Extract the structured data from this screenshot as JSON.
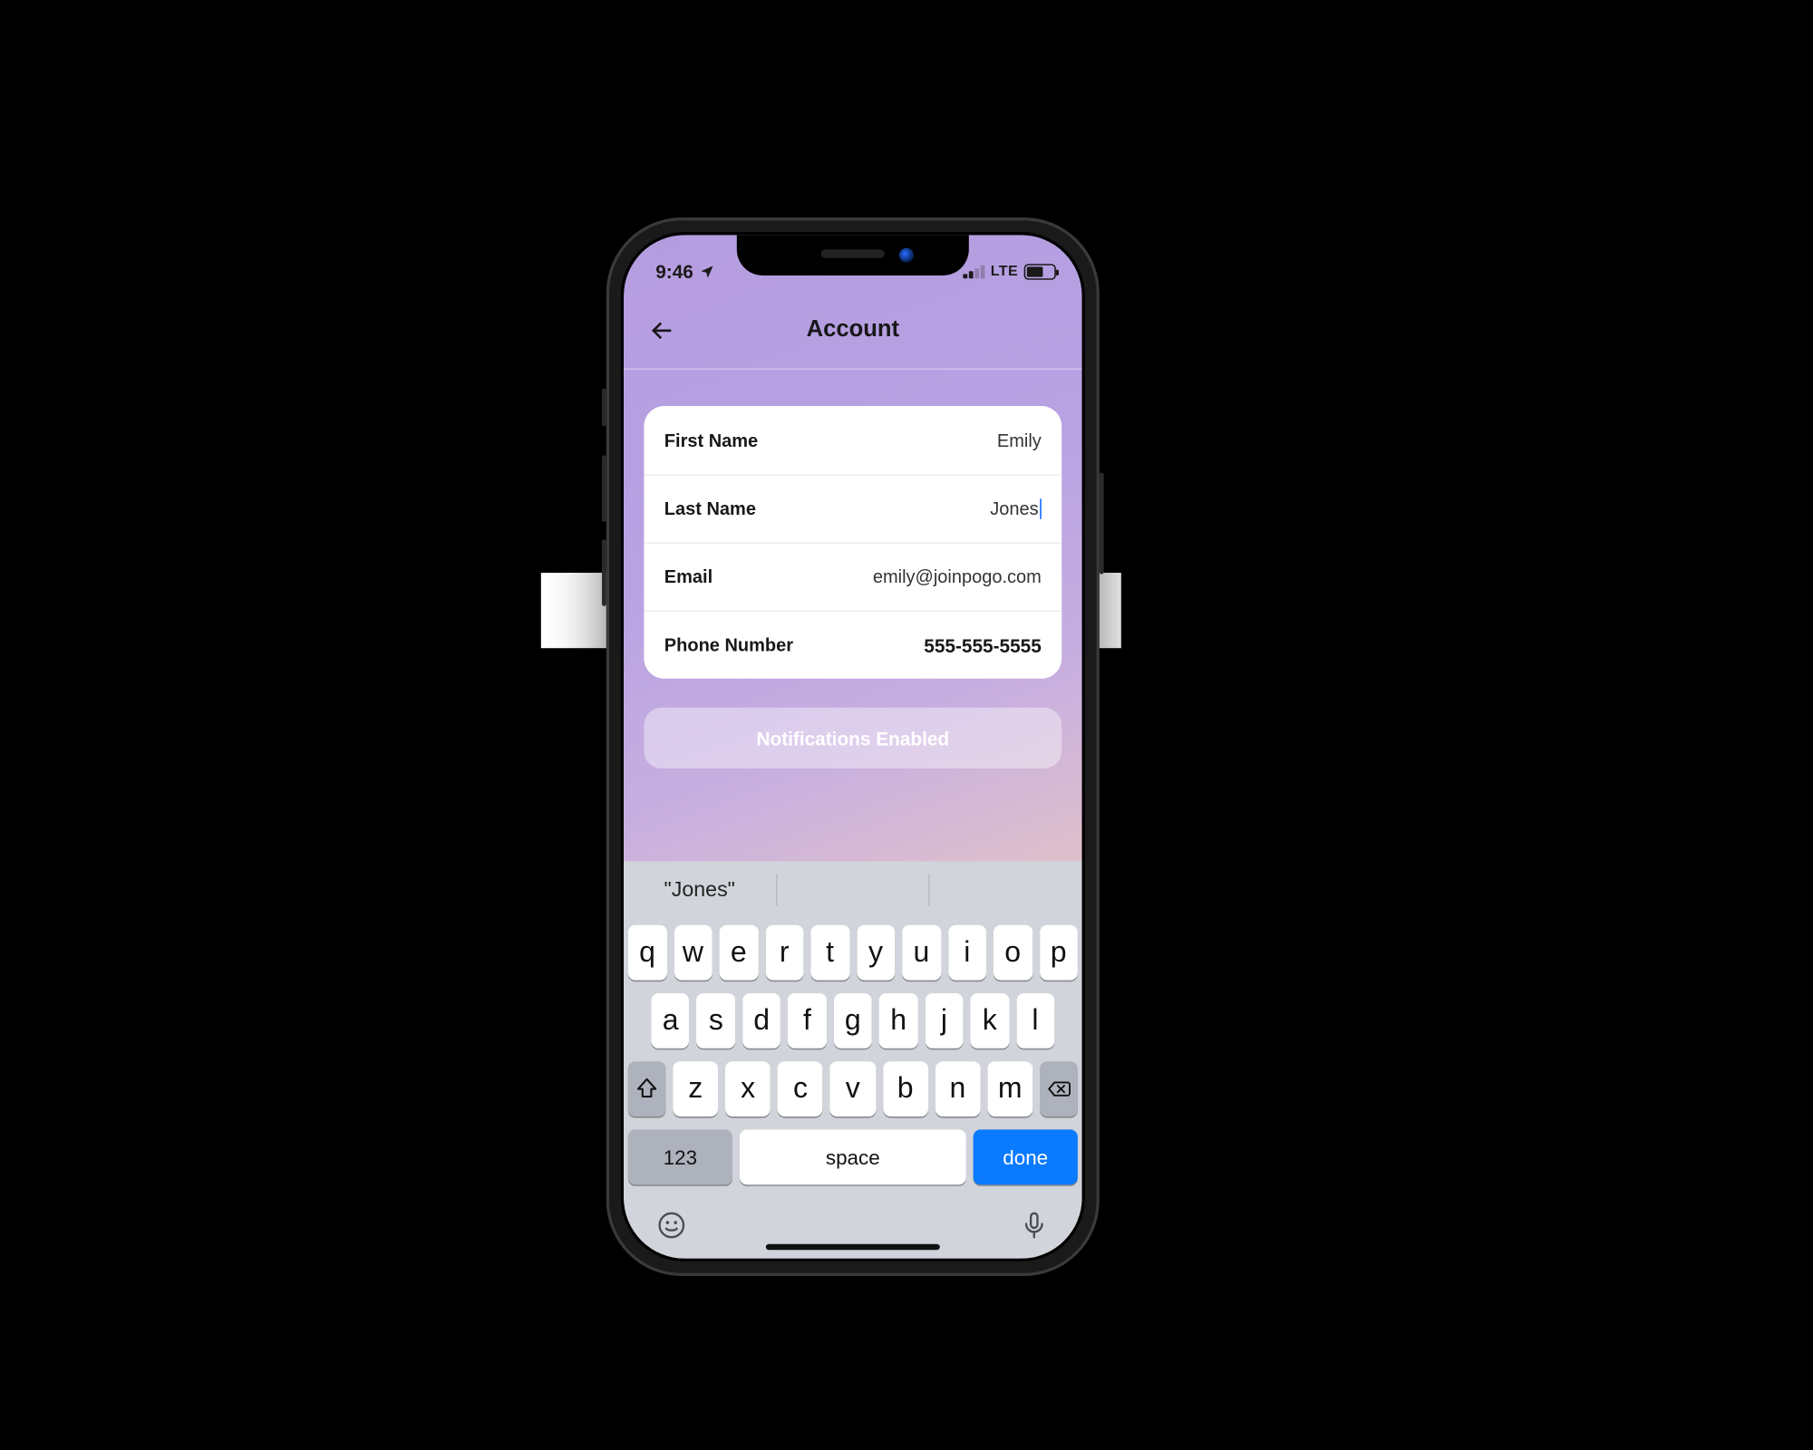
{
  "status": {
    "time": "9:46",
    "network_label": "LTE"
  },
  "header": {
    "title": "Account"
  },
  "form": {
    "first_name": {
      "label": "First Name",
      "value": "Emily"
    },
    "last_name": {
      "label": "Last Name",
      "value": "Jones"
    },
    "email": {
      "label": "Email",
      "value": "emily@joinpogo.com"
    },
    "phone": {
      "label": "Phone Number",
      "value": "555-555-5555"
    }
  },
  "notifications_button": "Notifications Enabled",
  "keyboard": {
    "suggestion": "\"Jones\"",
    "row1": [
      "q",
      "w",
      "e",
      "r",
      "t",
      "y",
      "u",
      "i",
      "o",
      "p"
    ],
    "row2": [
      "a",
      "s",
      "d",
      "f",
      "g",
      "h",
      "j",
      "k",
      "l"
    ],
    "row3": [
      "z",
      "x",
      "c",
      "v",
      "b",
      "n",
      "m"
    ],
    "numbers": "123",
    "space": "space",
    "done": "done"
  }
}
